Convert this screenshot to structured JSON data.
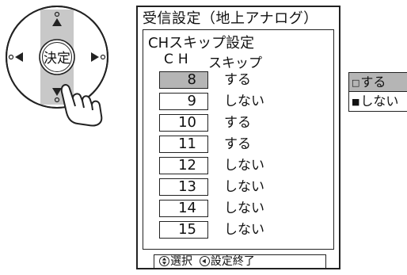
{
  "remote": {
    "center_label": "決定"
  },
  "panel": {
    "title": "受信設定（地上アナログ）",
    "subtitle": "CHスキップ設定",
    "header_ch": "CH",
    "header_skip": "スキップ",
    "rows": [
      {
        "ch": "8",
        "skip": "する",
        "selected": true
      },
      {
        "ch": "9",
        "skip": "しない",
        "selected": false
      },
      {
        "ch": "10",
        "skip": "する",
        "selected": false
      },
      {
        "ch": "11",
        "skip": "する",
        "selected": false
      },
      {
        "ch": "12",
        "skip": "しない",
        "selected": false
      },
      {
        "ch": "13",
        "skip": "しない",
        "selected": false
      },
      {
        "ch": "14",
        "skip": "しない",
        "selected": false
      },
      {
        "ch": "15",
        "skip": "しない",
        "selected": false
      }
    ],
    "footer": {
      "select_label": "選択",
      "finish_label": "設定終了"
    }
  },
  "popup": {
    "options": [
      {
        "mark": "□",
        "label": "する",
        "selected": true
      },
      {
        "mark": "■",
        "label": "しない",
        "selected": false
      }
    ]
  }
}
